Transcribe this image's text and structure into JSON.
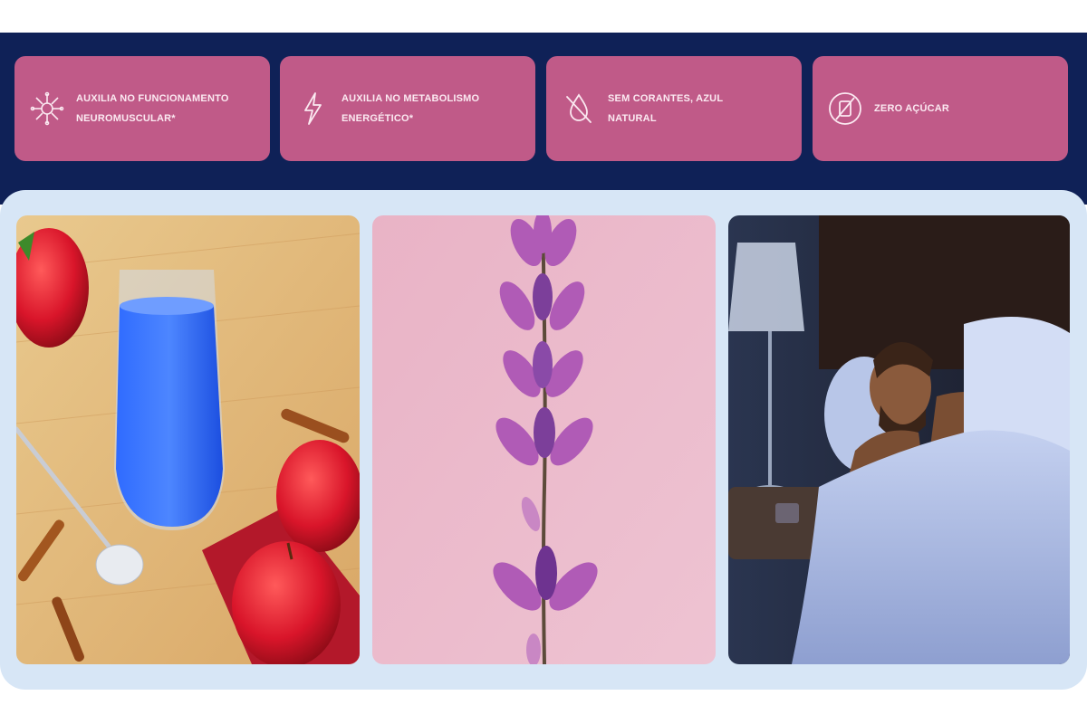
{
  "benefits": [
    {
      "icon": "neuromuscular-icon",
      "text": "Auxilia no funcionamento neuromuscular*"
    },
    {
      "icon": "lightning-bolt-icon",
      "text": "Auxilia no metabolismo energético*"
    },
    {
      "icon": "no-drop-icon",
      "text": "Sem corantes, azul natural"
    },
    {
      "icon": "no-sugar-icon",
      "text": "Zero açúcar"
    }
  ],
  "colors": {
    "navy": "#0f2157",
    "card_pink": "#c05a88",
    "panel_blue": "#d7e6f6"
  },
  "photos": [
    {
      "name": "blue-drink-apples-photo"
    },
    {
      "name": "lavender-flower-photo"
    },
    {
      "name": "man-sleeping-photo"
    }
  ]
}
